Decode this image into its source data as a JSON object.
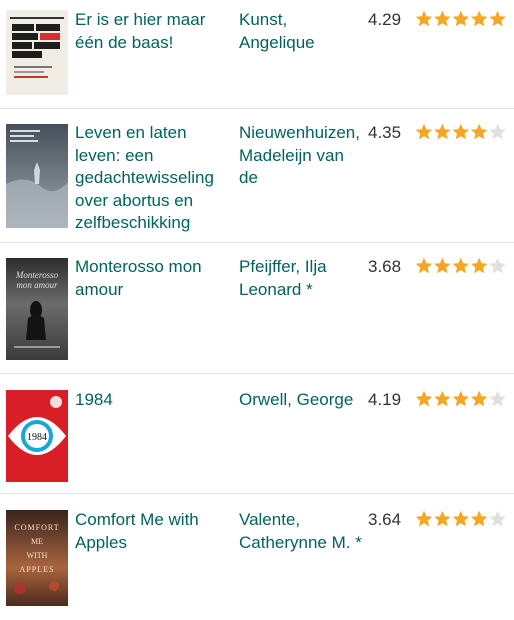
{
  "books": [
    {
      "title": "Er is er hier maar één de baas!",
      "author": "Kunst, Angelique",
      "avg_rating": "4.29",
      "stars_filled": 5,
      "cover_text": [
        "ANGELIQUE KUNST",
        "ER IS",
        "ER HIER",
        "MAAR",
        "ÉÉN",
        "DE",
        "BAAS!"
      ]
    },
    {
      "title": "Leven en laten leven: een gedachtewisseling over abortus en zelfbeschikking",
      "author": "Nieuwenhuizen, Madeleijn van de",
      "avg_rating": "4.35",
      "stars_filled": 4,
      "cover_text": []
    },
    {
      "title": "Monterosso mon amour",
      "author": "Pfeijffer, Ilja Leonard *",
      "avg_rating": "3.68",
      "stars_filled": 4,
      "cover_text": [
        "Monterosso",
        "mon amour"
      ]
    },
    {
      "title": "1984",
      "author": "Orwell, George",
      "avg_rating": "4.19",
      "stars_filled": 4,
      "cover_text": [
        "1984"
      ]
    },
    {
      "title": "Comfort Me with Apples",
      "author": "Valente, Catherynne M. *",
      "avg_rating": "3.64",
      "stars_filled": 4,
      "cover_text": [
        "COMFORT",
        "ME",
        "WITH",
        "APPLES"
      ]
    }
  ],
  "colors": {
    "link": "#00635d",
    "star_filled": "#f5a623",
    "star_empty": "#e0e0e0"
  },
  "icons": {
    "star": "star-icon"
  }
}
